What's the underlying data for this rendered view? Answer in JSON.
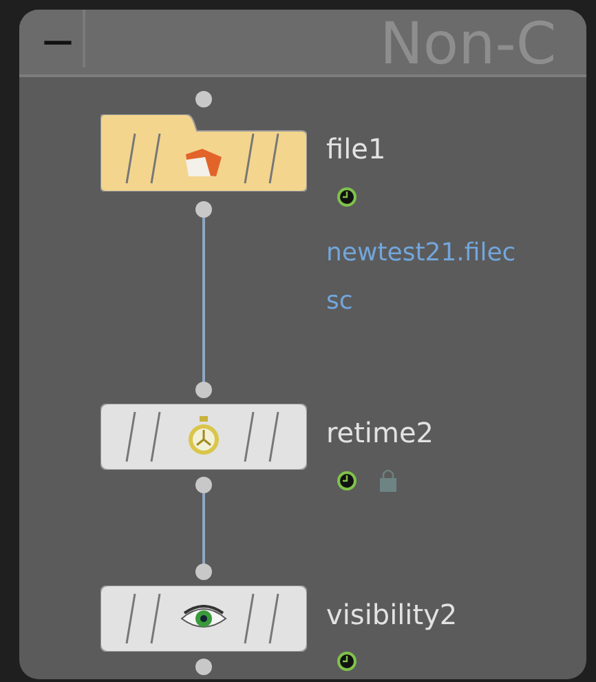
{
  "panel": {
    "collapse_glyph": "—",
    "watermark": "Non-C"
  },
  "nodes": [
    {
      "name": "file1",
      "kind": "file",
      "color": "#f3d58e",
      "locked": false,
      "comment": [
        "newtest21.filec",
        "sc"
      ]
    },
    {
      "name": "retime2",
      "kind": "retime",
      "color": "#e2e2e2",
      "locked": true
    },
    {
      "name": "visibility2",
      "kind": "visibility",
      "color": "#e2e2e2",
      "locked": false
    }
  ]
}
